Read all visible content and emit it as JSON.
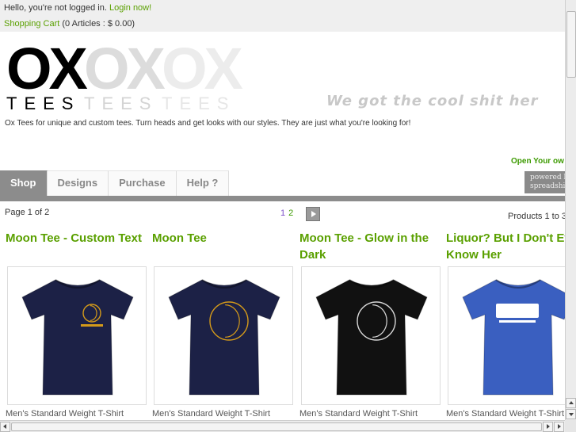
{
  "topbar": {
    "greeting": "Hello, you're not logged in.",
    "login_link": "Login now!",
    "cart_link": "Shopping Cart",
    "cart_summary": "(0 Articles : $ 0.00)"
  },
  "header": {
    "logo_ox": "OX",
    "logo_tees": "TEES",
    "slogan": "We got the cool shit her",
    "tagline": "Ox Tees for unique and custom tees. Turn heads and get looks with our styles. They are just what you're looking for!",
    "open_shop": "Open Your ow",
    "powered_line1": "powered by",
    "powered_line2": "spreadshi"
  },
  "tabs": [
    {
      "label": "Shop",
      "active": true
    },
    {
      "label": "Designs",
      "active": false
    },
    {
      "label": "Purchase",
      "active": false
    },
    {
      "label": "Help ?",
      "active": false
    }
  ],
  "pager": {
    "info": "Page 1 of 2",
    "current": "1",
    "next": "2",
    "count": "Products 1 to 3"
  },
  "products": [
    {
      "title": "Moon Tee - Custom Text",
      "type": "Men's Standard Weight T-Shirt",
      "shirt_color": "#1c2146",
      "print": "moon-text",
      "print_color": "#d49a1a"
    },
    {
      "title": "Moon Tee",
      "type": "Men's Standard Weight T-Shirt",
      "shirt_color": "#1c2146",
      "print": "moon",
      "print_color": "#d49a1a"
    },
    {
      "title": "Moon Tee - Glow in the Dark",
      "type": "Men's Standard Weight T-Shirt",
      "shirt_color": "#111111",
      "print": "moon",
      "print_color": "#d8d8d8"
    },
    {
      "title": "Liquor? But I Don't Even Know Her",
      "type": "Men's Standard Weight T-Shirt",
      "shirt_color": "#3a5fc0",
      "print": "liquor",
      "print_color": "#ffffff"
    }
  ],
  "colors": {
    "accent_green": "#5aa000",
    "tab_active": "#8c8c8c"
  }
}
